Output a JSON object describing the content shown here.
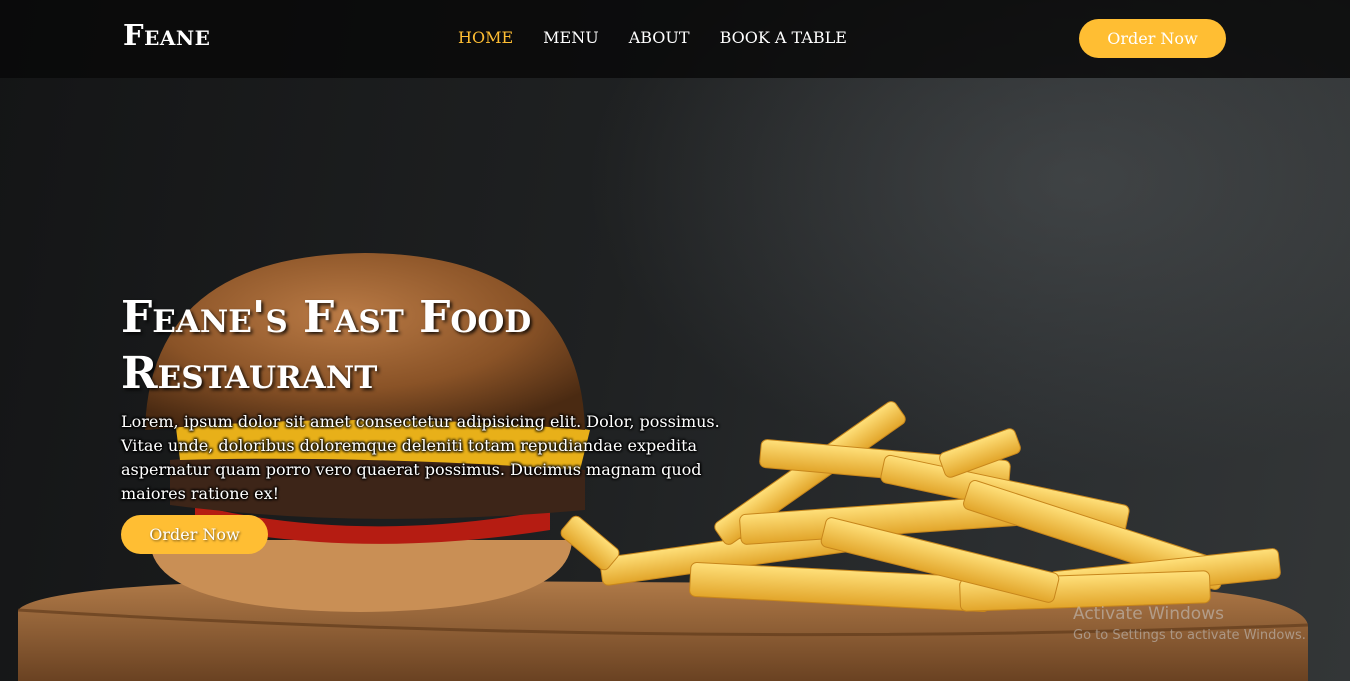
{
  "brand": {
    "name": "Feane"
  },
  "nav": {
    "items": [
      {
        "label": "HOME",
        "active": true
      },
      {
        "label": "MENU",
        "active": false
      },
      {
        "label": "ABOUT",
        "active": false
      },
      {
        "label": "BOOK A TABLE",
        "active": false
      }
    ]
  },
  "header": {
    "order_label": "Order Now"
  },
  "hero": {
    "title": "Feane's Fast Food Restaurant",
    "description": "Lorem, ipsum dolor sit amet consectetur adipisicing elit. Dolor, possimus. Vitae unde, doloribus doloremque deleniti totam repudiandae expedita aspernatur quam porro vero quaerat possimus. Ducimus magnam quod maiores ratione ex!",
    "order_label": "Order Now"
  },
  "watermark": {
    "title": "Activate Windows",
    "subtitle": "Go to Settings to activate Windows."
  },
  "colors": {
    "accent": "#ffbe33",
    "header_bg": "#0a0a0a",
    "text": "#ffffff"
  }
}
